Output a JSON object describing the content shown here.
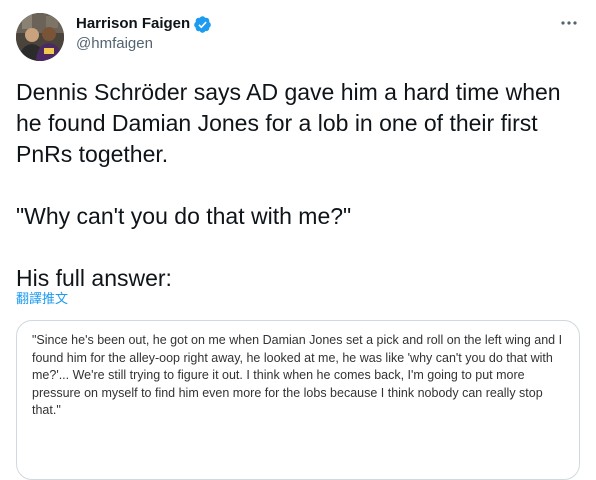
{
  "author": {
    "display_name": "Harrison Faigen",
    "handle": "@hmfaigen",
    "verified": true,
    "avatar_icon": "profile-photo"
  },
  "tweet": {
    "text": "Dennis Schröder says AD gave him a hard time when\nhe found Damian Jones for a lob in one of their first\nPnRs together.\n\n\"Why can't you do that with me?\"\n\nHis full answer:",
    "translate_label": "翻譯推文"
  },
  "media": {
    "quote_text": "\"Since he's been out, he got on me when Damian Jones set a pick and roll on the left wing and I found him for the alley-oop right away, he looked at me, he was like 'why can't you do that with me?'... We're still trying to figure it out. I think when he comes back, I'm going to put more pressure on myself to find him even more for the lobs because I think nobody can really stop that.\""
  },
  "colors": {
    "accent": "#1d9bf0",
    "text_primary": "#0f1419",
    "text_secondary": "#536471",
    "border": "#cfd9de"
  },
  "icons": {
    "verified": "verified-badge-icon",
    "more": "more-horizontal-icon"
  }
}
